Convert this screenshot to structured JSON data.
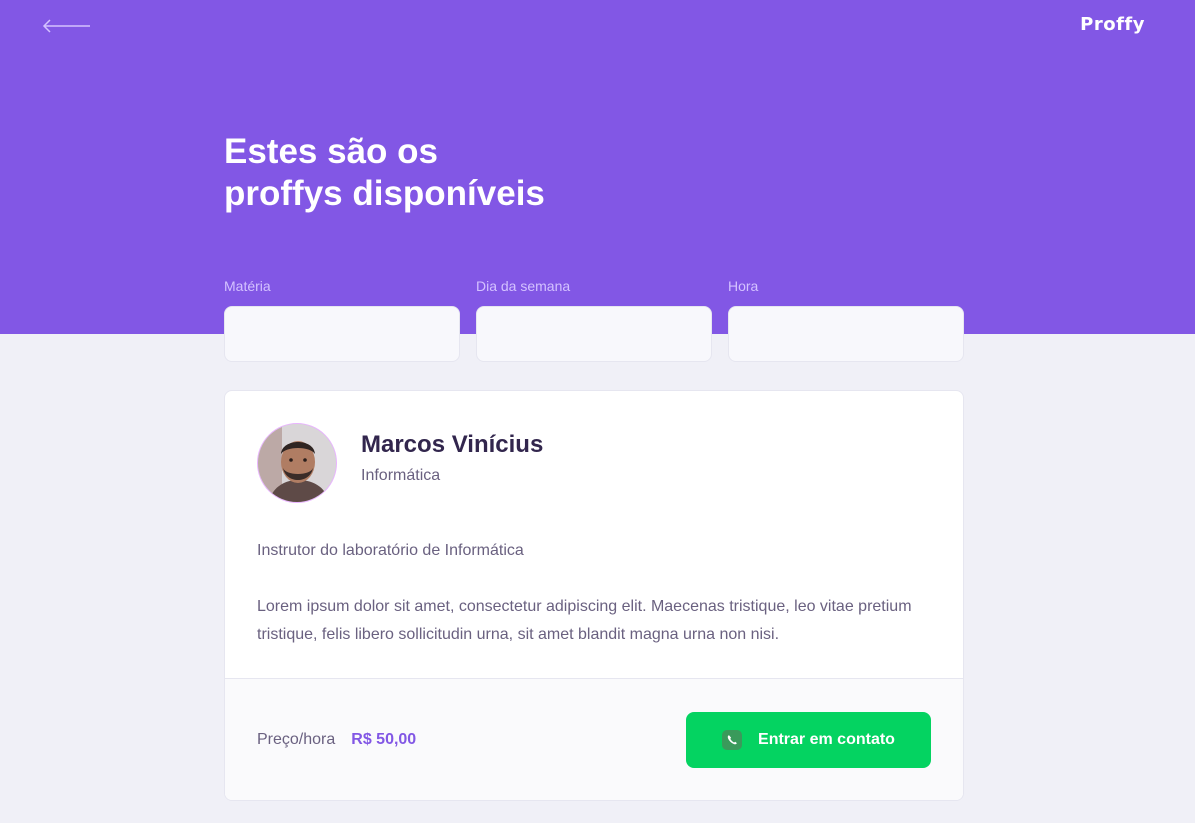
{
  "header": {
    "back_icon": "arrow-left-icon",
    "logo": "Proffy",
    "title_line1": "Estes são os",
    "title_line2": "proffys disponíveis"
  },
  "filters": [
    {
      "label": "Matéria",
      "value": ""
    },
    {
      "label": "Dia da semana",
      "value": ""
    },
    {
      "label": "Hora",
      "value": ""
    }
  ],
  "teacher": {
    "name": "Marcos Vinícius",
    "subject": "Informática",
    "bio_1": "Instrutor do laboratório de Informática",
    "bio_2": "Lorem ipsum dolor sit amet, consectetur adipiscing elit. Maecenas tristique, leo vitae pretium tristique, felis libero sollicitudin urna, sit amet blandit magna urna non nisi.",
    "price_label": "Preço/hora",
    "price_value": "R$ 50,00",
    "contact_label": "Entrar em contato",
    "contact_icon": "whatsapp-icon"
  },
  "colors": {
    "primary": "#8257E5",
    "background": "#F0F0F7",
    "secondary": "#04D361",
    "title_text": "#32264D",
    "body_text": "#6A6180"
  }
}
